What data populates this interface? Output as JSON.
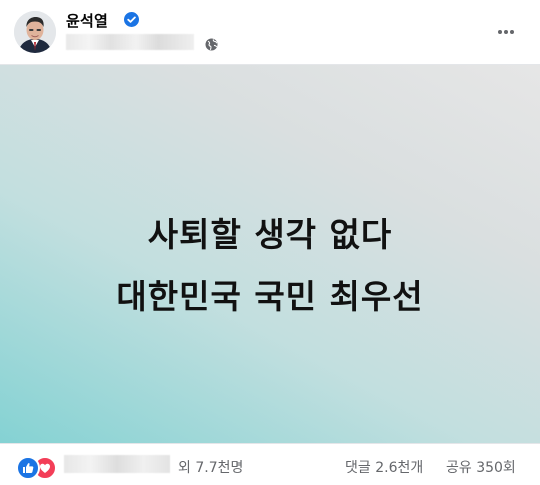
{
  "post": {
    "author_name": "윤석열",
    "headline_line1": "사퇴할 생각 없다",
    "headline_line2": "대한민국 국민 최우선",
    "reactions": {
      "summary": "외 7.7천명",
      "types": [
        "like-icon",
        "love-icon"
      ]
    },
    "comments": "댓글 2.6천개",
    "shares": "공유 350회"
  },
  "colors": {
    "verified_badge": "#1b74e4",
    "like": "#1b74e4",
    "love": "#f33e58",
    "secondary_text": "#65676b",
    "gradient_teal": "#84d2d3",
    "gradient_grey": "#e6e6e6"
  },
  "icons": [
    "verified-badge-icon",
    "globe-icon",
    "more-options-icon",
    "like-icon",
    "love-icon"
  ]
}
